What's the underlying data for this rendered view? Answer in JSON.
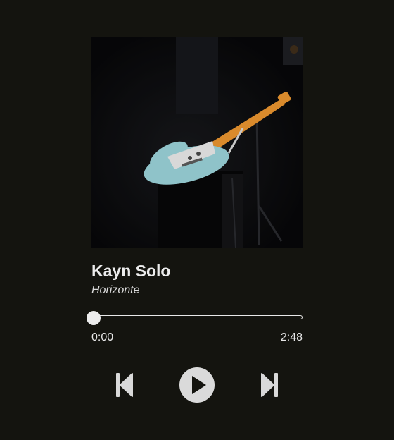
{
  "track": {
    "artist": "Kayn Solo",
    "album": "Horizonte",
    "current_time": "0:00",
    "duration": "2:48",
    "progress": 0
  },
  "icons": {
    "previous": "skip-previous-icon",
    "play": "play-icon",
    "next": "skip-next-icon"
  },
  "colors": {
    "background": "#14140f",
    "foreground": "#e6e6e6",
    "guitar_body": "#8fc3c9",
    "guitar_neck": "#d98a2c"
  }
}
